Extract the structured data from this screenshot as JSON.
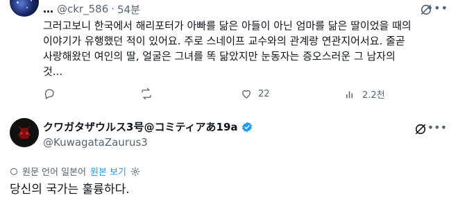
{
  "tweet1": {
    "more_dots": "…",
    "handle": "@ckr_586",
    "separator": "·",
    "time": "54분",
    "text": "그러고보니 한국에서 해리포터가 아빠를 닮은 아들이 아닌 엄마를 닮은 딸이었을 때의\n이야기가 유행했던 적이 있어요. 주로 스네이프 교수와의 관계랑 연관지어서요. 줄곧\n사랑해왔던 여인의 딸, 얼굴은 그녀를 똑 닮았지만 눈동자는 증오스러운 그 남자의\n것...",
    "actions": {
      "reply_count": "",
      "retweet_count": "",
      "like_count": "22",
      "views_count": "2.2천"
    }
  },
  "tweet2": {
    "name": "クワガタザウルス3号@コミティアあ19a",
    "handle": "@KuwagataZaurus3",
    "translation_note": "원문 언어 일본어",
    "show_original": "원본 보기",
    "text": "당신의 국가는 훌륭하다."
  },
  "colors": {
    "accent": "#1d9bf0",
    "muted": "#536471",
    "text": "#0f1419"
  }
}
